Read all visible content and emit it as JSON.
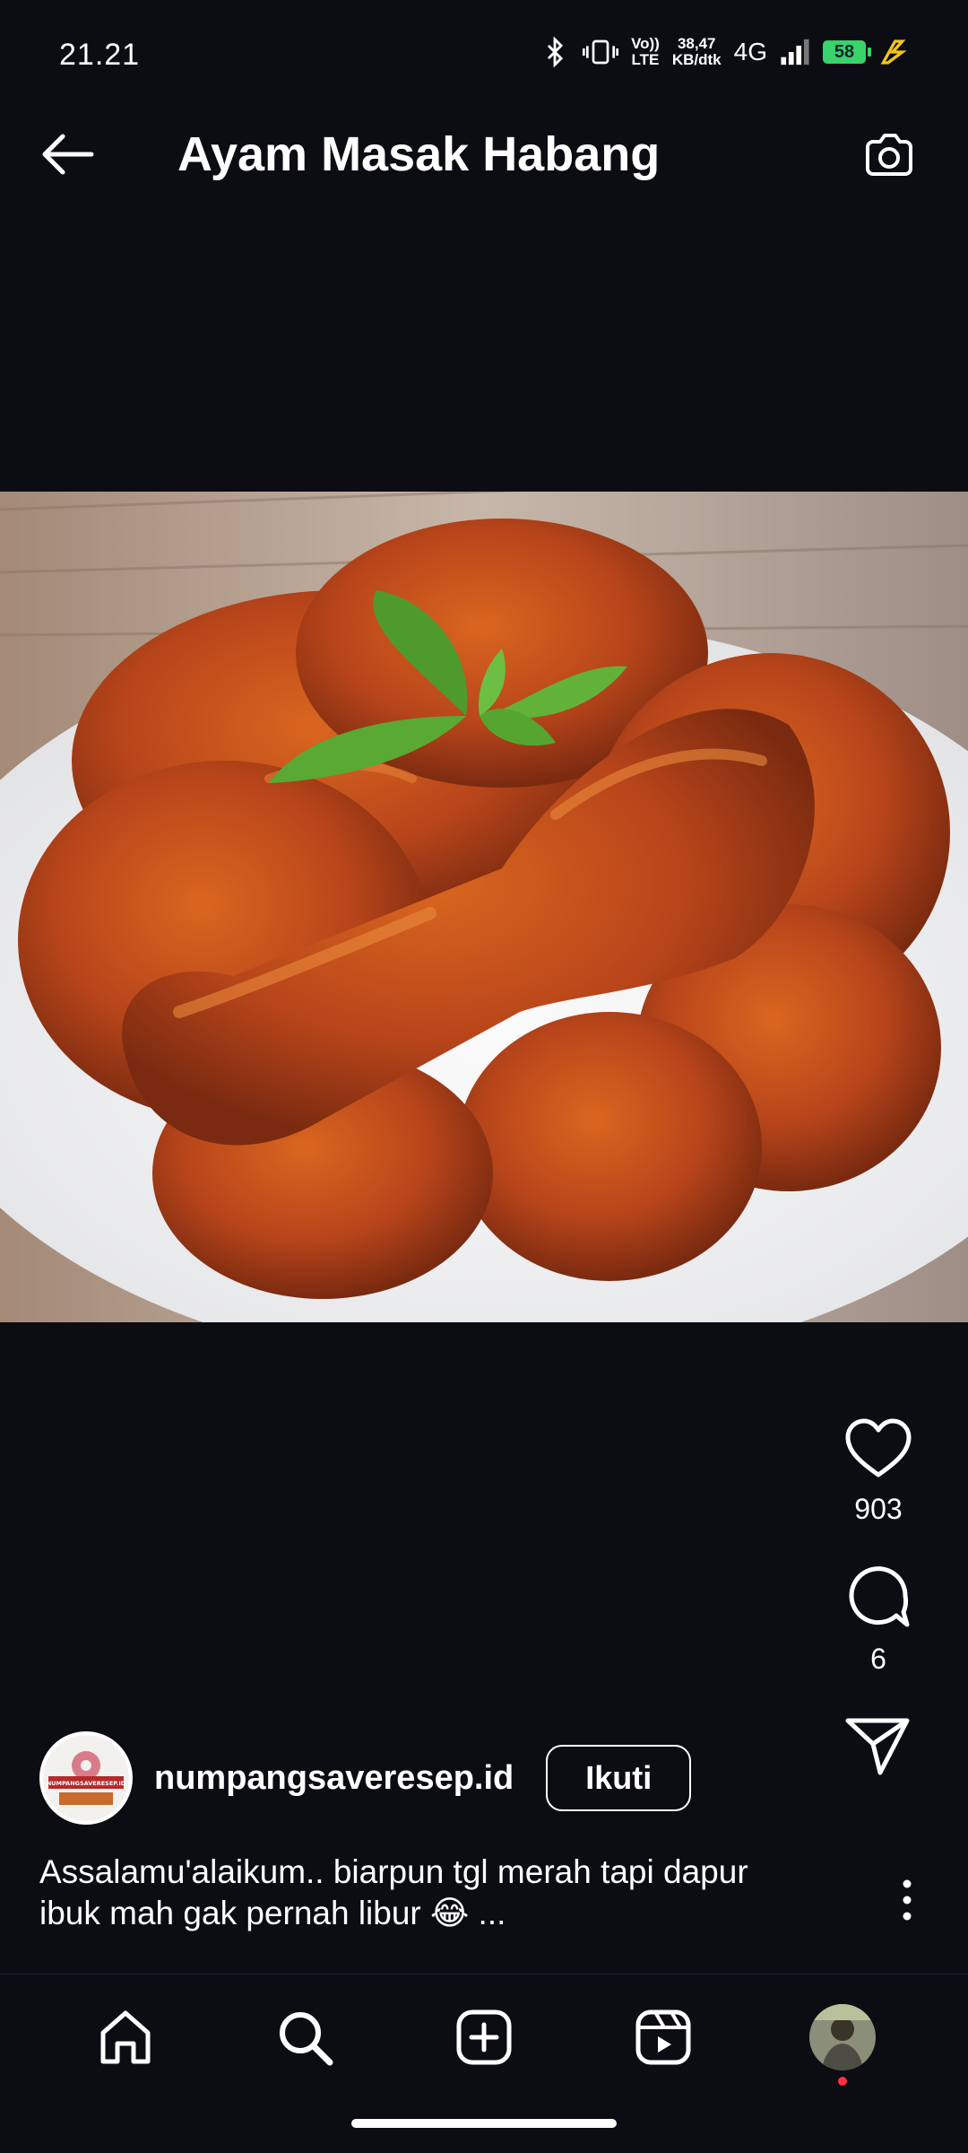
{
  "status_bar": {
    "time": "21.21",
    "volte_top": "Vo))",
    "volte_bottom": "LTE",
    "speed_value": "38,47",
    "speed_unit": "KB/dtk",
    "network": "4G",
    "battery": "58"
  },
  "header": {
    "title": "Ayam Masak Habang",
    "back_icon": "back-arrow-icon",
    "camera_icon": "camera-icon"
  },
  "actions": {
    "likes": "903",
    "comments": "6"
  },
  "post": {
    "username": "numpangsaveresep.id",
    "follow_label": "Ikuti",
    "caption": "Assalamu'alaikum.. biarpun tgl merah tapi dapur ibuk mah gak pernah libur 😂 ...",
    "avatar_text": "NUMPANGSAVERESEP.ID"
  },
  "nav": {
    "items": [
      "home-icon",
      "search-icon",
      "create-icon",
      "reels-icon",
      "profile-avatar"
    ]
  },
  "colors": {
    "background": "#0b0d12",
    "notification_dot": "#ff3040",
    "battery": "#38d36b",
    "sauce": "#c4501c"
  }
}
